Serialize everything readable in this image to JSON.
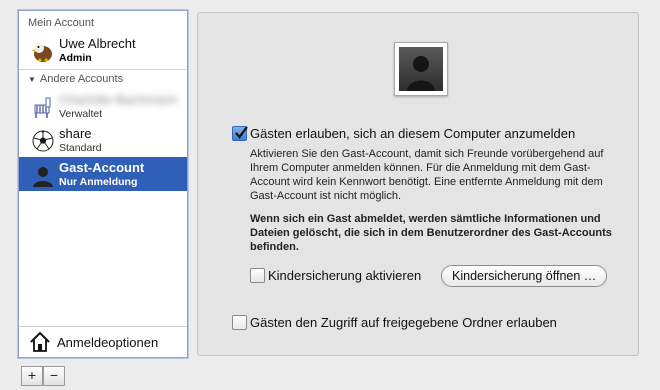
{
  "sidebar": {
    "my_account_header": "Mein Account",
    "other_accounts_header": "Andere Accounts",
    "users": [
      {
        "name": "Uwe Albrecht",
        "role": "Admin"
      },
      {
        "name": "Charlotte Bachmann",
        "role": "Verwaltet"
      },
      {
        "name": "share",
        "role": "Standard"
      },
      {
        "name": "Gast-Account",
        "role": "Nur Anmeldung"
      }
    ],
    "login_options_label": "Anmeldeoptionen"
  },
  "buttons": {
    "add": "+",
    "remove": "−"
  },
  "main": {
    "allow_guests_label": "Gästen erlauben, sich an diesem Computer anzumelden",
    "allow_guests_checked": true,
    "description": "Aktivieren Sie den Gast-Account, damit sich Freunde vorübergehend auf Ihrem Computer anmelden können. Für die Anmeldung mit dem Gast-Account wird kein Kennwort benötigt. Eine entfernte Anmeldung mit dem Gast-Account ist nicht möglich.",
    "warning": "Wenn sich ein Gast abmeldet, werden sämtliche Informationen und Dateien gelöscht, die sich in dem Benutzerordner des Gast-Accounts befinden.",
    "parental_controls_label": "Kindersicherung aktivieren",
    "parental_controls_checked": false,
    "open_parental_controls_button": "Kindersicherung öffnen …",
    "shared_folders_label": "Gästen den Zugriff auf freigegebene Ordner erlauben",
    "shared_folders_checked": false
  },
  "colors": {
    "selection": "#2f5fb6",
    "checkbox_accent": "#3f7fd6"
  }
}
